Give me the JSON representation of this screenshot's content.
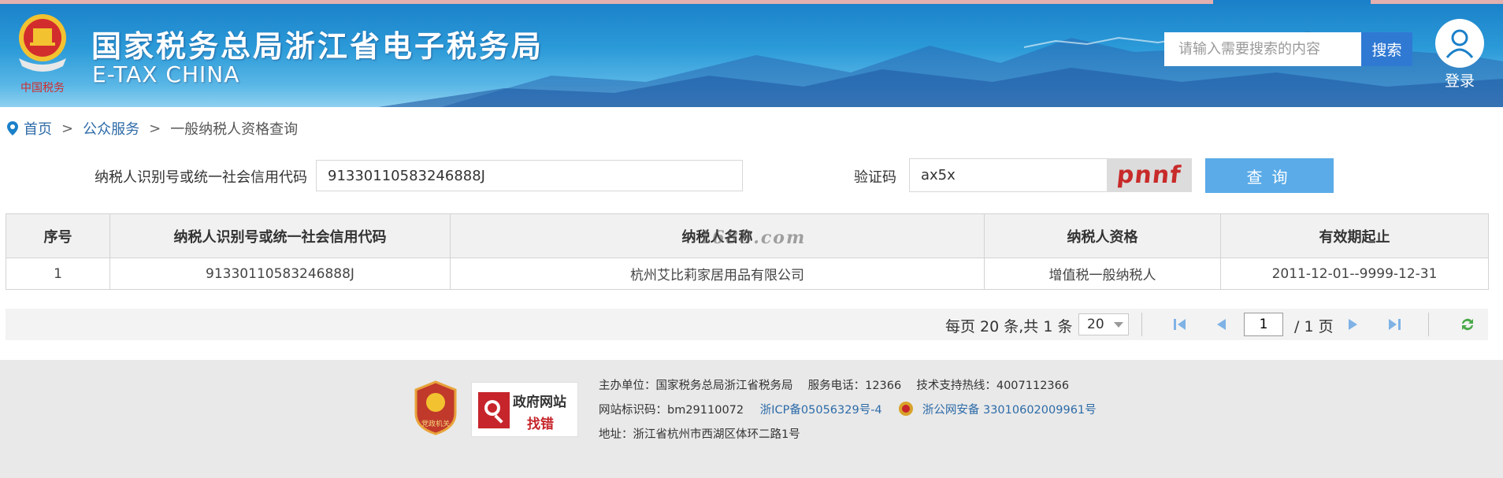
{
  "header": {
    "title_cn": "国家税务总局浙江省电子税务局",
    "title_en": "E-TAX CHINA",
    "logo_caption": "中国税务",
    "search_placeholder": "请输入需要搜索的内容",
    "search_button": "搜索",
    "login_label": "登录"
  },
  "breadcrumb": {
    "home": "首页",
    "sep1": ">",
    "section": "公众服务",
    "sep2": ">",
    "current": "一般纳税人资格查询"
  },
  "form": {
    "taxpayer_id_label": "纳税人识别号或统一社会信用代码",
    "taxpayer_id_value": "91330110583246888J",
    "captcha_label": "验证码",
    "captcha_value": "ax5x",
    "captcha_image_text": "pnnf",
    "query_button": "查询"
  },
  "table": {
    "headers": [
      "序号",
      "纳税人识别号或统一社会信用代码",
      "纳税人名称",
      "纳税人资格",
      "有效期起止"
    ],
    "rows": [
      [
        "1",
        "91330110583246888J",
        "杭州艾比莉家居用品有限公司",
        "增值税一般纳税人",
        "2011-12-01--9999-12-31"
      ]
    ],
    "watermark": "1688.com"
  },
  "pager": {
    "summary": "每页 20 条,共 1 条",
    "page_size": "20",
    "current_page": "1",
    "total_pages": "/ 1 页"
  },
  "footer": {
    "badge1_text": "党政机关",
    "badge2_line1": "政府网站",
    "badge2_line2": "找错",
    "line1": "主办单位：国家税务总局浙江省税务局　 服务电话：12366　 技术支持热线：4007112366",
    "site_id": "网站标识码：bm29110072",
    "icp": "浙ICP备05056329号-4",
    "police": "浙公网安备 33010602009961号",
    "address": "地址：浙江省杭州市西湖区体环二路1号"
  },
  "colors": {
    "banner_blue": "#1a80c9",
    "search_button": "#2f79d3",
    "query_button": "#5aabe8",
    "link": "#2d6ba8",
    "captcha_red": "#c82a2a"
  }
}
